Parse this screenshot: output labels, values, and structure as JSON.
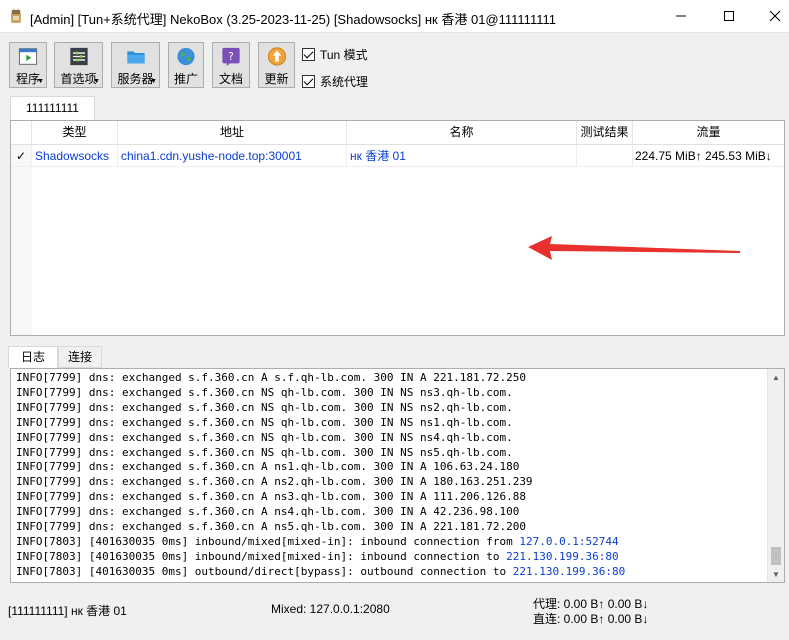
{
  "window": {
    "title": "[Admin] [Tun+系统代理] NekoBox (3.25-2023-11-25) [Shadowsocks] нк 香港 01@111111111"
  },
  "toolbar": {
    "program": "程序",
    "preferences": "首选项",
    "server": "服务器",
    "promote": "推广",
    "docs": "文档",
    "update": "更新",
    "tun_mode": "Tun 模式",
    "system_proxy": "系统代理"
  },
  "group_tab": "111111111",
  "table": {
    "headers": {
      "type": "类型",
      "address": "地址",
      "name": "名称",
      "test": "测试结果",
      "traffic": "流量"
    },
    "rows": [
      {
        "check": "✓",
        "type": "Shadowsocks",
        "address": "china1.cdn.yushe-node.top:30001",
        "name": "нк 香港 01",
        "test": "",
        "traffic": "224.75 MiB↑ 245.53 MiB↓"
      }
    ]
  },
  "log_tabs": {
    "log": "日志",
    "connections": "连接"
  },
  "log": {
    "lines": [
      {
        "text": "INFO[7799] dns: exchanged s.f.360.cn A s.f.qh-lb.com. 300 IN A 221.181.72.250",
        "ip": ""
      },
      {
        "text": "INFO[7799] dns: exchanged s.f.360.cn NS qh-lb.com. 300 IN NS ns3.qh-lb.com.",
        "ip": ""
      },
      {
        "text": "INFO[7799] dns: exchanged s.f.360.cn NS qh-lb.com. 300 IN NS ns2.qh-lb.com.",
        "ip": ""
      },
      {
        "text": "INFO[7799] dns: exchanged s.f.360.cn NS qh-lb.com. 300 IN NS ns1.qh-lb.com.",
        "ip": ""
      },
      {
        "text": "INFO[7799] dns: exchanged s.f.360.cn NS qh-lb.com. 300 IN NS ns4.qh-lb.com.",
        "ip": ""
      },
      {
        "text": "INFO[7799] dns: exchanged s.f.360.cn NS qh-lb.com. 300 IN NS ns5.qh-lb.com.",
        "ip": ""
      },
      {
        "text": "INFO[7799] dns: exchanged s.f.360.cn A ns1.qh-lb.com. 300 IN A 106.63.24.180",
        "ip": ""
      },
      {
        "text": "INFO[7799] dns: exchanged s.f.360.cn A ns2.qh-lb.com. 300 IN A 180.163.251.239",
        "ip": ""
      },
      {
        "text": "INFO[7799] dns: exchanged s.f.360.cn A ns3.qh-lb.com. 300 IN A 111.206.126.88",
        "ip": ""
      },
      {
        "text": "INFO[7799] dns: exchanged s.f.360.cn A ns4.qh-lb.com. 300 IN A 42.236.98.100",
        "ip": ""
      },
      {
        "text": "INFO[7799] dns: exchanged s.f.360.cn A ns5.qh-lb.com. 300 IN A 221.181.72.200",
        "ip": ""
      },
      {
        "text": "INFO[7803] [401630035 0ms] inbound/mixed[mixed-in]: inbound connection from ",
        "ip": "127.0.0.1:52744"
      },
      {
        "text": "INFO[7803] [401630035 0ms] inbound/mixed[mixed-in]: inbound connection to ",
        "ip": "221.130.199.36:80"
      },
      {
        "text": "INFO[7803] [401630035 0ms] outbound/direct[bypass]: outbound connection to ",
        "ip": "221.130.199.36:80"
      }
    ]
  },
  "status": {
    "profile": "[111111111] нк 香港 01",
    "mixed": "Mixed: 127.0.0.1:2080",
    "proxy": "代理: 0.00 B↑ 0.00 B↓",
    "direct": "直连: 0.00 B↑ 0.00 B↓"
  },
  "colors": {
    "link_blue": "#0a3ecf",
    "arrow_red": "#e8302c"
  }
}
